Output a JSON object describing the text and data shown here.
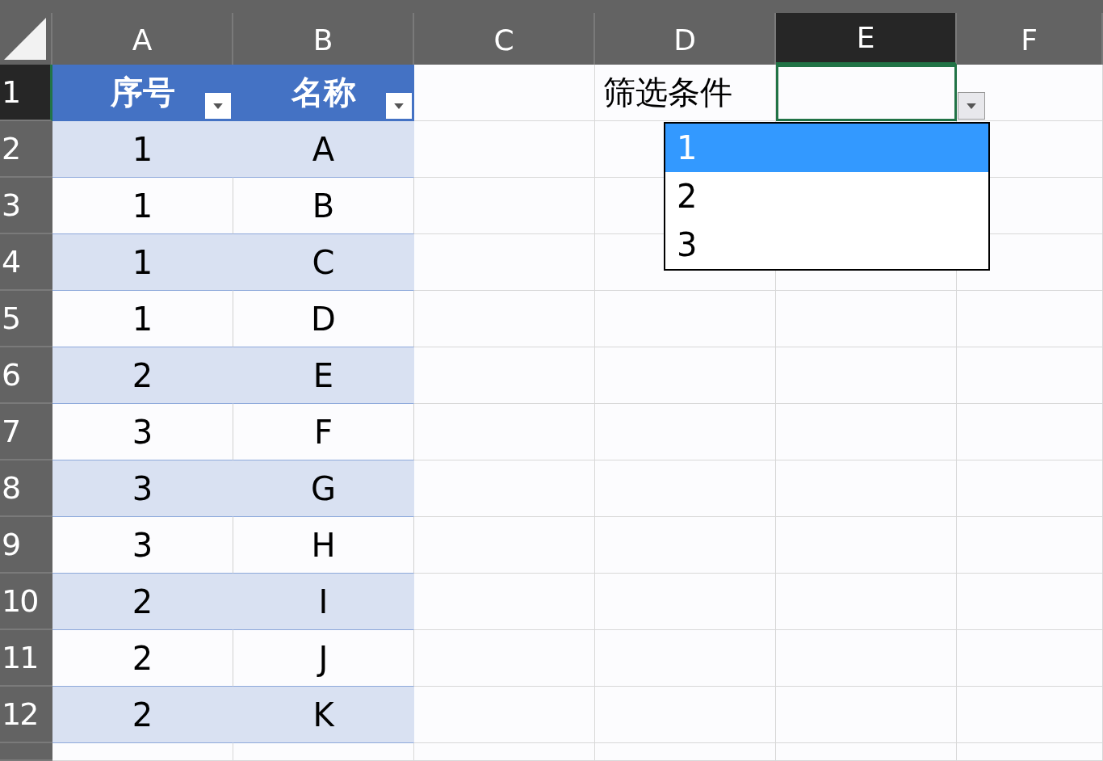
{
  "columns": [
    {
      "label": "A",
      "selected": false
    },
    {
      "label": "B",
      "selected": false
    },
    {
      "label": "C",
      "selected": false
    },
    {
      "label": "D",
      "selected": false
    },
    {
      "label": "E",
      "selected": true
    },
    {
      "label": "F",
      "selected": false
    }
  ],
  "rows": [
    {
      "label": "1",
      "selected": true
    },
    {
      "label": "2",
      "selected": false
    },
    {
      "label": "3",
      "selected": false
    },
    {
      "label": "4",
      "selected": false
    },
    {
      "label": "5",
      "selected": false
    },
    {
      "label": "6",
      "selected": false
    },
    {
      "label": "7",
      "selected": false
    },
    {
      "label": "8",
      "selected": false
    },
    {
      "label": "9",
      "selected": false
    },
    {
      "label": "10",
      "selected": false
    },
    {
      "label": "11",
      "selected": false
    },
    {
      "label": "12",
      "selected": false
    }
  ],
  "table": {
    "headers": [
      "序号",
      "名称"
    ],
    "rows": [
      [
        "1",
        "A"
      ],
      [
        "1",
        "B"
      ],
      [
        "1",
        "C"
      ],
      [
        "1",
        "D"
      ],
      [
        "2",
        "E"
      ],
      [
        "3",
        "F"
      ],
      [
        "3",
        "G"
      ],
      [
        "3",
        "H"
      ],
      [
        "2",
        "I"
      ],
      [
        "2",
        "J"
      ],
      [
        "2",
        "K"
      ]
    ]
  },
  "criteria_label": "筛选条件",
  "dropdown": {
    "options": [
      {
        "text": "1",
        "selected": true
      },
      {
        "text": "2",
        "selected": false
      },
      {
        "text": "3",
        "selected": false
      }
    ]
  }
}
